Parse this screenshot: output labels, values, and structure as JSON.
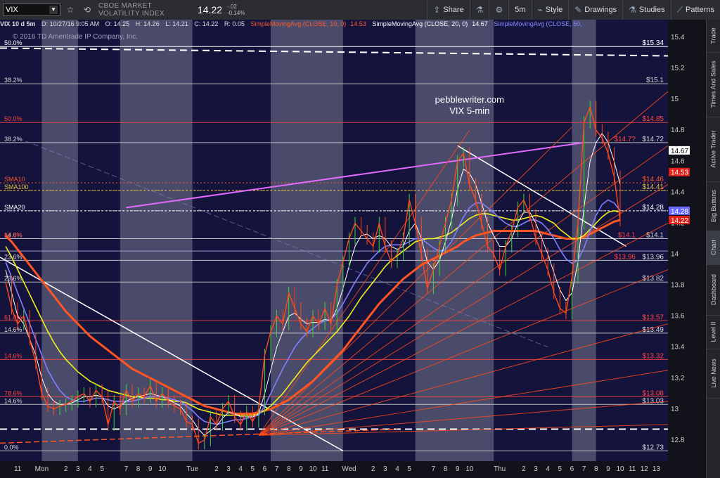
{
  "toolbar": {
    "symbol": "VIX",
    "description": "CBOE MARKET VOLATILITY INDEX",
    "price": "14.22",
    "change": "-.02",
    "change_pct": "-0.14%",
    "timeframe": "5m",
    "share_label": "Share",
    "style_label": "Style",
    "drawings_label": "Drawings",
    "studies_label": "Studies",
    "patterns_label": "Patterns"
  },
  "infobar": {
    "title": "VIX 10 d 5m",
    "datetime": "D: 10/27/16 9:05 AM",
    "open": "O: 14.25",
    "high": "H: 14.26",
    "low": "L: 14.21",
    "close": "C: 14.22",
    "range": "R: 0.05",
    "sma10": "SimpleMovingAvg (CLOSE, 10, 0)",
    "sma10_value": "14.53",
    "sma20": "SimpleMovingAvg (CLOSE, 20, 0)",
    "sma20_value": "14.67",
    "sma50": "SimpleMovingAvg (CLOSE, 50,"
  },
  "side_tabs": [
    "Trade",
    "Times And Sales",
    "Active Trader",
    "Big Buttons",
    "Chart",
    "Dashboard",
    "Level II",
    "Live News"
  ],
  "active_tab": "Chart",
  "chart_data": {
    "type": "line",
    "watermark": "© 2016 TD Ameritrade IP Company, Inc.",
    "annotation": [
      "pebblewriter.com",
      "VIX 5-min"
    ],
    "ylim": [
      12.7,
      15.45
    ],
    "y_ticks": [
      12.8,
      13,
      13.2,
      13.4,
      13.6,
      13.8,
      14,
      14.2,
      14.4,
      14.6,
      14.8,
      15,
      15.2,
      15.4
    ],
    "y_tick_labels": [
      "12.8",
      "13",
      "13.2",
      "13.4",
      "13.6",
      "13.8",
      "14",
      "14.2",
      "14.4",
      "14.6",
      "14.8",
      "15",
      "15.2",
      "15.4"
    ],
    "x_ticks": [
      {
        "i": 2,
        "label": "11"
      },
      {
        "i": 6,
        "label": "Mon"
      },
      {
        "i": 10,
        "label": "2"
      },
      {
        "i": 12,
        "label": "3"
      },
      {
        "i": 14,
        "label": "4"
      },
      {
        "i": 16,
        "label": "5"
      },
      {
        "i": 20,
        "label": "7"
      },
      {
        "i": 22,
        "label": "8"
      },
      {
        "i": 24,
        "label": "9"
      },
      {
        "i": 26,
        "label": "10"
      },
      {
        "i": 31,
        "label": "Tue"
      },
      {
        "i": 35,
        "label": "2"
      },
      {
        "i": 37,
        "label": "3"
      },
      {
        "i": 39,
        "label": "4"
      },
      {
        "i": 41,
        "label": "5"
      },
      {
        "i": 43,
        "label": "6"
      },
      {
        "i": 45,
        "label": "7"
      },
      {
        "i": 47,
        "label": "8"
      },
      {
        "i": 49,
        "label": "9"
      },
      {
        "i": 51,
        "label": "10"
      },
      {
        "i": 53,
        "label": "11"
      },
      {
        "i": 57,
        "label": "Wed"
      },
      {
        "i": 61,
        "label": "2"
      },
      {
        "i": 63,
        "label": "3"
      },
      {
        "i": 65,
        "label": "4"
      },
      {
        "i": 67,
        "label": "5"
      },
      {
        "i": 71,
        "label": "7"
      },
      {
        "i": 73,
        "label": "8"
      },
      {
        "i": 75,
        "label": "9"
      },
      {
        "i": 77,
        "label": "10"
      },
      {
        "i": 82,
        "label": "Thu"
      },
      {
        "i": 86,
        "label": "2"
      },
      {
        "i": 88,
        "label": "3"
      },
      {
        "i": 90,
        "label": "4"
      },
      {
        "i": 92,
        "label": "5"
      },
      {
        "i": 94,
        "label": "6"
      },
      {
        "i": 96,
        "label": "7"
      },
      {
        "i": 98,
        "label": "8"
      },
      {
        "i": 100,
        "label": "9"
      },
      {
        "i": 102,
        "label": "10"
      },
      {
        "i": 104,
        "label": "11"
      },
      {
        "i": 106,
        "label": "12"
      },
      {
        "i": 108,
        "label": "13"
      }
    ],
    "x_count": 110,
    "bands": [
      [
        6,
        12
      ],
      [
        19,
        31
      ],
      [
        44,
        56
      ],
      [
        68,
        81
      ],
      [
        94,
        98
      ]
    ],
    "price": {
      "name": "VIX",
      "color": "#ff4a1a",
      "values": [
        13.82,
        13.65,
        13.55,
        13.6,
        13.45,
        13.3,
        13.1,
        13.02,
        13.0,
        13.02,
        13.03,
        13.05,
        13.08,
        13.1,
        13.05,
        13.12,
        13.08,
        12.9,
        13.05,
        13.0,
        13.12,
        13.05,
        13.1,
        13.08,
        13.15,
        13.05,
        13.1,
        13.05,
        13.02,
        13.0,
        12.92,
        12.9,
        12.78,
        12.8,
        12.95,
        12.9,
        13.0,
        13.05,
        12.95,
        12.9,
        12.98,
        12.92,
        13.0,
        13.35,
        13.5,
        13.6,
        13.55,
        13.75,
        13.65,
        13.55,
        13.5,
        13.6,
        13.55,
        13.65,
        13.55,
        13.8,
        13.95,
        14.1,
        14.2,
        14.15,
        14.1,
        14.05,
        14.2,
        14.05,
        13.95,
        14.0,
        14.1,
        14.35,
        14.2,
        14.0,
        13.78,
        13.9,
        14.05,
        14.2,
        14.35,
        14.6,
        14.65,
        14.45,
        14.35,
        14.2,
        14.05,
        14.0,
        13.9,
        14.05,
        14.15,
        14.3,
        14.35,
        14.25,
        14.1,
        14.0,
        13.9,
        13.75,
        13.65,
        13.62,
        13.85,
        14.2,
        14.85,
        14.95,
        14.8,
        14.75,
        14.65,
        14.5,
        14.22
      ]
    },
    "sma10": {
      "color": "#ffffff",
      "values": [
        13.9,
        13.75,
        13.6,
        13.55,
        13.45,
        13.35,
        13.2,
        13.1,
        13.05,
        13.03,
        13.03,
        13.04,
        13.06,
        13.08,
        13.08,
        13.09,
        13.08,
        13.02,
        13.0,
        13.02,
        13.05,
        13.07,
        13.08,
        13.09,
        13.1,
        13.09,
        13.08,
        13.06,
        13.04,
        13.02,
        12.97,
        12.93,
        12.87,
        12.83,
        12.86,
        12.89,
        12.94,
        12.98,
        12.97,
        12.95,
        12.95,
        12.95,
        12.97,
        13.1,
        13.25,
        13.4,
        13.5,
        13.6,
        13.62,
        13.58,
        13.55,
        13.56,
        13.56,
        13.58,
        13.57,
        13.65,
        13.78,
        13.92,
        14.05,
        14.12,
        14.13,
        14.1,
        14.12,
        14.1,
        14.05,
        14.03,
        14.05,
        14.15,
        14.2,
        14.1,
        13.95,
        13.9,
        13.96,
        14.08,
        14.22,
        14.42,
        14.55,
        14.52,
        14.45,
        14.33,
        14.2,
        14.12,
        14.05,
        14.05,
        14.1,
        14.2,
        14.27,
        14.27,
        14.2,
        14.1,
        14.0,
        13.88,
        13.77,
        13.7,
        13.75,
        13.95,
        14.3,
        14.6,
        14.72,
        14.78,
        14.72,
        14.6,
        14.45
      ]
    },
    "sma20": {
      "color": "#8080ff",
      "values": [
        13.95,
        13.85,
        13.75,
        13.65,
        13.55,
        13.45,
        13.35,
        13.25,
        13.18,
        13.12,
        13.08,
        13.06,
        13.05,
        13.05,
        13.06,
        13.07,
        13.07,
        13.06,
        13.05,
        13.05,
        13.05,
        13.05,
        13.06,
        13.07,
        13.08,
        13.08,
        13.08,
        13.07,
        13.06,
        13.05,
        13.02,
        12.99,
        12.95,
        12.92,
        12.91,
        12.9,
        12.91,
        12.92,
        12.93,
        12.93,
        12.94,
        12.95,
        12.96,
        13.02,
        13.1,
        13.18,
        13.26,
        13.33,
        13.4,
        13.45,
        13.49,
        13.52,
        13.55,
        13.57,
        13.58,
        13.62,
        13.68,
        13.75,
        13.82,
        13.88,
        13.94,
        13.98,
        14.02,
        14.05,
        14.06,
        14.06,
        14.06,
        14.08,
        14.1,
        14.1,
        14.07,
        14.04,
        14.02,
        14.03,
        14.08,
        14.16,
        14.24,
        14.3,
        14.33,
        14.33,
        14.3,
        14.27,
        14.23,
        14.2,
        14.18,
        14.18,
        14.2,
        14.22,
        14.22,
        14.2,
        14.16,
        14.1,
        14.03,
        13.97,
        13.94,
        13.96,
        14.04,
        14.15,
        14.25,
        14.32,
        14.35,
        14.33,
        14.28
      ]
    },
    "sma50": {
      "color": "#f0f020",
      "values": [
        14.05,
        13.98,
        13.9,
        13.82,
        13.74,
        13.66,
        13.58,
        13.5,
        13.43,
        13.37,
        13.32,
        13.28,
        13.24,
        13.21,
        13.18,
        13.16,
        13.14,
        13.12,
        13.11,
        13.1,
        13.09,
        13.08,
        13.08,
        13.07,
        13.07,
        13.07,
        13.06,
        13.06,
        13.05,
        13.05,
        13.04,
        13.02,
        13.0,
        12.99,
        12.98,
        12.97,
        12.96,
        12.96,
        12.96,
        12.96,
        12.96,
        12.96,
        12.97,
        12.99,
        13.02,
        13.06,
        13.1,
        13.15,
        13.2,
        13.25,
        13.3,
        13.34,
        13.38,
        13.42,
        13.46,
        13.5,
        13.55,
        13.6,
        13.66,
        13.72,
        13.77,
        13.82,
        13.87,
        13.92,
        13.96,
        13.99,
        14.02,
        14.05,
        14.08,
        14.09,
        14.1,
        14.1,
        14.11,
        14.12,
        14.14,
        14.17,
        14.2,
        14.23,
        14.25,
        14.26,
        14.26,
        14.25,
        14.24,
        14.23,
        14.22,
        14.22,
        14.23,
        14.24,
        14.25,
        14.24,
        14.22,
        14.2,
        14.16,
        14.13,
        14.1,
        14.1,
        14.12,
        14.16,
        14.2,
        14.24,
        14.27,
        14.28,
        14.27
      ]
    },
    "sma100": {
      "color": "#ff5522",
      "values": [
        14.12,
        14.08,
        14.03,
        13.98,
        13.93,
        13.88,
        13.83,
        13.78,
        13.73,
        13.68,
        13.63,
        13.59,
        13.55,
        13.51,
        13.47,
        13.44,
        13.41,
        13.38,
        13.35,
        13.32,
        13.29,
        13.26,
        13.24,
        13.22,
        13.2,
        13.18,
        13.16,
        13.14,
        13.12,
        13.1,
        13.08,
        13.06,
        13.04,
        13.02,
        13.01,
        13.0,
        12.99,
        12.98,
        12.97,
        12.97,
        12.97,
        12.97,
        12.98,
        12.99,
        13.0,
        13.02,
        13.04,
        13.06,
        13.09,
        13.12,
        13.15,
        13.18,
        13.22,
        13.26,
        13.3,
        13.34,
        13.38,
        13.43,
        13.48,
        13.53,
        13.58,
        13.63,
        13.68,
        13.72,
        13.76,
        13.8,
        13.84,
        13.87,
        13.9,
        13.93,
        13.95,
        13.97,
        13.99,
        14.01,
        14.03,
        14.05,
        14.08,
        14.1,
        14.12,
        14.13,
        14.14,
        14.15,
        14.15,
        14.15,
        14.15,
        14.15,
        14.15,
        14.15,
        14.15,
        14.14,
        14.13,
        14.12,
        14.11,
        14.1,
        14.1,
        14.1,
        14.11,
        14.13,
        14.15,
        14.17,
        14.19,
        14.21,
        14.22
      ]
    },
    "h_levels": [
      {
        "y": 15.1,
        "label": "$15.1",
        "color": "#d8d8d8",
        "fib": "38.2%",
        "fib_color": "#d8d8d8"
      },
      {
        "y": 14.85,
        "label": "$14.85",
        "color": "#ff4444",
        "fib": "50.0%",
        "fib_color": "#ff4444"
      },
      {
        "y": 14.72,
        "label": "$14.72",
        "color": "#d8d8d8",
        "fib": "38.2%",
        "fib_color": "#d8d8d8"
      },
      {
        "y": 14.41,
        "label": "$14.41",
        "color": "#e6c13a",
        "dash": true
      },
      {
        "y": 14.28,
        "label": "$14.28",
        "color": "#ffffff",
        "dash": true
      },
      {
        "y": 14.1,
        "label": "$14.1",
        "color": "#d8d8d8",
        "fib": "14.6%",
        "fib_color": "#d8d8d8"
      },
      {
        "y": 13.96,
        "label": "$13.96",
        "color": "#d8d8d8",
        "fib": "23.6%",
        "fib_color": "#d8d8d8"
      },
      {
        "y": 13.82,
        "label": "$13.82",
        "color": "#d8d8d8",
        "fib": "23.6%",
        "fib_color": "#d8d8d8"
      },
      {
        "y": 13.57,
        "label": "$13.57",
        "color": "#ff4444"
      },
      {
        "y": 13.49,
        "label": "$13.49",
        "color": "#d8d8d8",
        "fib": "14.6%",
        "fib_color": "#d8d8d8"
      },
      {
        "y": 13.32,
        "label": "$13.32",
        "color": "#ff4444",
        "fib": "14.6%",
        "fib_color": "#ff4444"
      },
      {
        "y": 13.08,
        "label": "$13.08",
        "color": "#ff4444",
        "fib": "78.6%",
        "fib_color": "#ff4444"
      },
      {
        "y": 13.03,
        "label": "$13.03",
        "color": "#d8d8d8",
        "fib": "14.6%",
        "fib_color": "#d8d8d8"
      },
      {
        "y": 12.73,
        "label": "$12.73",
        "color": "#d8d8d8",
        "fib": "0.0%",
        "fib_color": "#d8d8d8"
      }
    ],
    "top_level": {
      "y": 15.34,
      "label": "$15.34",
      "fib": "50.0%"
    },
    "sma_labels": [
      {
        "y": 14.46,
        "label": "SMA10",
        "color": "#ff5a2a",
        "value": "$14.46"
      },
      {
        "y": 14.41,
        "label": "SMA100",
        "color": "#e6c13a"
      },
      {
        "y": 14.28,
        "label": "SMA20",
        "color": "#ffffff"
      }
    ],
    "extra_labels": [
      {
        "y": 14.72,
        "label": "$14.7?",
        "color": "#ff4444"
      },
      {
        "y": 14.1,
        "label": "$14.1",
        "color": "#ff4444"
      },
      {
        "y": 14.1,
        "label": "61.8%",
        "color": "#ff4444",
        "side": "left"
      },
      {
        "y": 13.57,
        "label": "61.8%",
        "color": "#ff4444",
        "side": "left"
      },
      {
        "y": 13.96,
        "label": "$13.96",
        "color": "#ff4444"
      }
    ],
    "price_tags": [
      {
        "y": 14.67,
        "label": "14.67",
        "bg": "#ffffff",
        "fg": "#000000"
      },
      {
        "y": 14.53,
        "label": "14.53",
        "bg": "#e0201a",
        "fg": "#ffffff"
      },
      {
        "y": 14.28,
        "label": "14.28",
        "bg": "#6a6aff",
        "fg": "#ffffff"
      },
      {
        "y": 14.22,
        "label": "14.22",
        "bg": "#e0201a",
        "fg": "#ffffff"
      }
    ]
  }
}
